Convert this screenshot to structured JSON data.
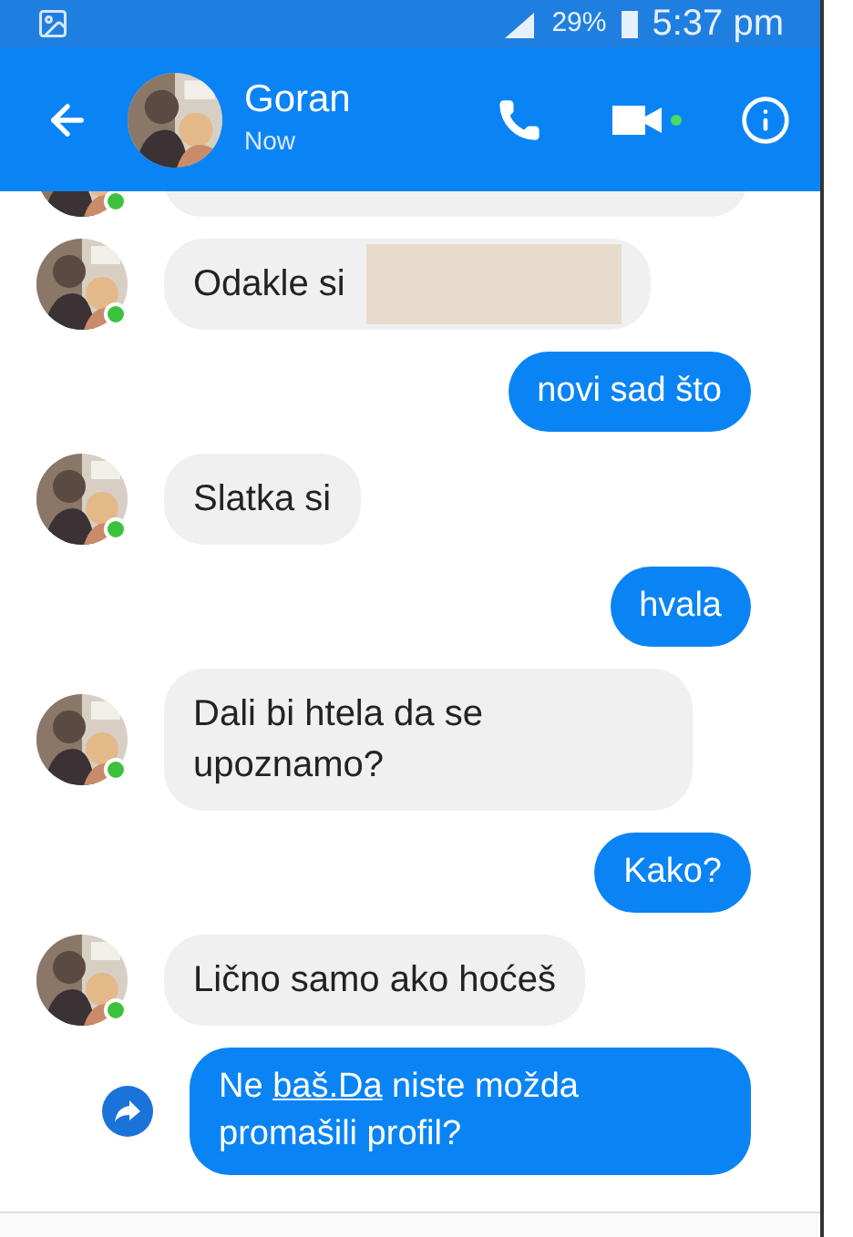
{
  "status_bar": {
    "battery": "29%",
    "time": "5:37 pm"
  },
  "header": {
    "name": "Goran",
    "status": "Now"
  },
  "messages": [
    {
      "kind": "incoming_partial",
      "online": true
    },
    {
      "kind": "incoming_redacted",
      "text": "Odakle si",
      "online": true
    },
    {
      "kind": "outgoing",
      "text": "novi sad što"
    },
    {
      "kind": "incoming",
      "text": "Slatka si",
      "online": true
    },
    {
      "kind": "outgoing",
      "text": "hvala"
    },
    {
      "kind": "incoming",
      "text": "Dali bi htela da se upoznamo?",
      "online": true
    },
    {
      "kind": "outgoing",
      "text": "Kako?"
    },
    {
      "kind": "incoming",
      "text": "Lično samo ako hoćeš",
      "online": true
    },
    {
      "kind": "outgoing_shared",
      "parts": [
        {
          "text": "Ne "
        },
        {
          "text": "baš.Da",
          "kind": "link"
        },
        {
          "text": " niste možda promašili profil?"
        }
      ]
    }
  ]
}
